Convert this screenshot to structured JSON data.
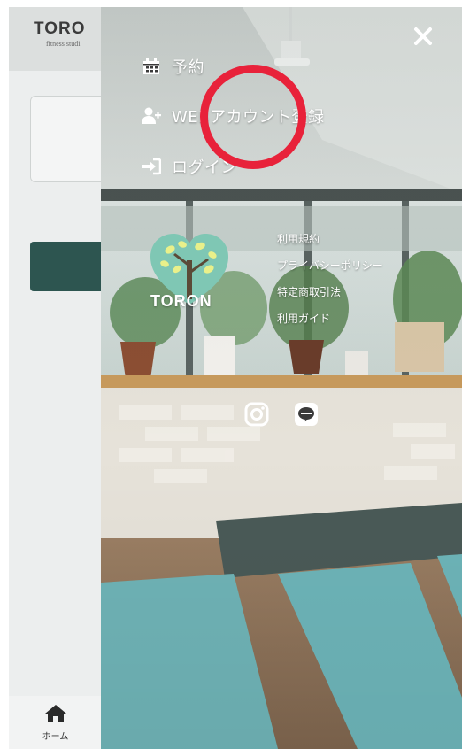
{
  "app": {
    "brand_name": "TORO",
    "brand_sub": "fitness studi",
    "bottom_nav": {
      "home_label": "ホーム"
    }
  },
  "drawer": {
    "menu": [
      {
        "label": "予約",
        "icon": "calendar-icon"
      },
      {
        "label": "WEBアカウント登録",
        "icon": "user-plus-icon"
      },
      {
        "label": "ログイン",
        "icon": "sign-in-icon"
      }
    ],
    "logo_text": "TORON",
    "links": [
      "利用規約",
      "プライバシーポリシー",
      "特定商取引法",
      "利用ガイド"
    ],
    "social": [
      "instagram-icon",
      "line-icon"
    ]
  },
  "colors": {
    "annotation": "#e8223a",
    "app_button": "#2d5550",
    "logo_heart": "#7fc7b4"
  }
}
